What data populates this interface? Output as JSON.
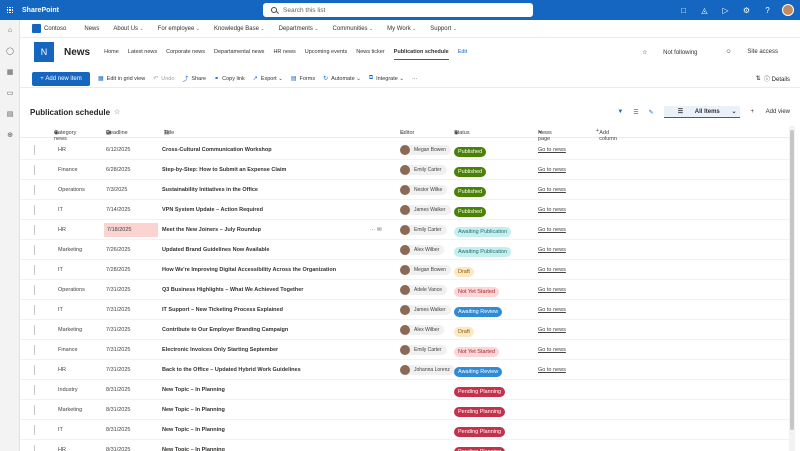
{
  "suite": {
    "app_name": "SharePoint",
    "search_placeholder": "Search this list"
  },
  "hub": {
    "name": "Contoso",
    "items": [
      "News",
      "About Us",
      "For employee",
      "Knowledge Base",
      "Departments",
      "Communities",
      "My Work",
      "Support"
    ]
  },
  "site": {
    "logo_letter": "N",
    "title": "News",
    "nav": [
      "Home",
      "Latest news",
      "Corporate news",
      "Departamental news",
      "HR news",
      "Upcoming events",
      "News ticker",
      "Publication schedule",
      "Edit"
    ],
    "active_nav": "Publication schedule",
    "not_following": "Not following",
    "site_access": "Site access"
  },
  "commands": {
    "new_item": "Add new item",
    "edit_grid": "Edit in grid view",
    "undo": "Undo",
    "share": "Share",
    "copy_link": "Copy link",
    "export": "Export",
    "forms": "Forms",
    "automate": "Automate",
    "integrate": "Integrate",
    "more": "···",
    "details": "Details"
  },
  "view": {
    "title": "Publication schedule",
    "current_view": "All Items",
    "add_view": "Add view"
  },
  "columns": {
    "category": "Category news",
    "deadline": "Deadline",
    "title": "Title",
    "editor": "Editor",
    "status": "Status",
    "news_page": "News page",
    "add_column": "Add column"
  },
  "status_colors": {
    "Published": {
      "bg": "#498205",
      "fg": "#ffffff"
    },
    "Awaiting Publication": {
      "bg": "#c3efef",
      "fg": "#2b6f6f"
    },
    "Draft": {
      "bg": "#fde8c4",
      "fg": "#8a5a00"
    },
    "Not Yet Started": {
      "bg": "#fcd6d7",
      "fg": "#a4262c"
    },
    "Awaiting Review": {
      "bg": "#2f8bd8",
      "fg": "#ffffff"
    },
    "Pending Planning": {
      "bg": "#c4314b",
      "fg": "#ffffff"
    }
  },
  "rows": [
    {
      "category": "HR",
      "deadline": "6/12/2025",
      "title": "Cross-Cultural Communication Workshop",
      "editor": "Megan Bowen",
      "status": "Published",
      "link": "Go to news"
    },
    {
      "category": "Finance",
      "deadline": "6/28/2025",
      "title": "Step-by-Step: How to Submit an Expense Claim",
      "editor": "Emily Carter",
      "status": "Published",
      "link": "Go to news"
    },
    {
      "category": "Operations",
      "deadline": "7/3/2025",
      "title": "Sustainability Initiatives in the Office",
      "editor": "Nestor Wilke",
      "status": "Published",
      "link": "Go to news"
    },
    {
      "category": "IT",
      "deadline": "7/14/2025",
      "title": "VPN System Update – Action Required",
      "editor": "James Walker",
      "status": "Published",
      "link": "Go to news"
    },
    {
      "category": "HR",
      "deadline": "7/18/2025",
      "title": "Meet the New Joiners – July Roundup",
      "editor": "Emily Carter",
      "status": "Awaiting Publication",
      "link": "Go to news",
      "highlight": true
    },
    {
      "category": "Marketing",
      "deadline": "7/26/2025",
      "title": "Updated Brand Guidelines Now Available",
      "editor": "Alex Wilber",
      "status": "Awaiting Publication",
      "link": "Go to news"
    },
    {
      "category": "IT",
      "deadline": "7/28/2025",
      "title": "How We're Improving Digital Accessibility Across the Organization",
      "editor": "Megan Bowen",
      "status": "Draft",
      "link": "Go to news"
    },
    {
      "category": "Operations",
      "deadline": "7/31/2025",
      "title": "Q3 Business Highlights – What We Achieved Together",
      "editor": "Adele Vance",
      "status": "Not Yet Started",
      "link": "Go to news"
    },
    {
      "category": "IT",
      "deadline": "7/31/2025",
      "title": "IT Support – New Ticketing Process Explained",
      "editor": "James Walker",
      "status": "Awaiting Review",
      "link": "Go to news"
    },
    {
      "category": "Marketing",
      "deadline": "7/31/2025",
      "title": "Contribute to Our Employer Branding Campaign",
      "editor": "Alex Wilber",
      "status": "Draft",
      "link": "Go to news"
    },
    {
      "category": "Finance",
      "deadline": "7/31/2025",
      "title": "Electronic Invoices Only Starting September",
      "editor": "Emily Carter",
      "status": "Not Yet Started",
      "link": "Go to news"
    },
    {
      "category": "HR",
      "deadline": "7/31/2025",
      "title": "Back to the Office – Updated Hybrid Work Guidelines",
      "editor": "Johanna Lorenz",
      "status": "Awaiting Review",
      "link": "Go to news"
    },
    {
      "category": "Industry",
      "deadline": "8/31/2025",
      "title": "New Topic – In Planning",
      "editor": "",
      "status": "Pending Planning",
      "link": ""
    },
    {
      "category": "Marketing",
      "deadline": "8/31/2025",
      "title": "New Topic – In Planning",
      "editor": "",
      "status": "Pending Planning",
      "link": ""
    },
    {
      "category": "IT",
      "deadline": "8/31/2025",
      "title": "New Topic – In Planning",
      "editor": "",
      "status": "Pending Planning",
      "link": ""
    },
    {
      "category": "HR",
      "deadline": "8/31/2025",
      "title": "New Topic – In Planning",
      "editor": "",
      "status": "Pending Planning",
      "link": ""
    }
  ]
}
